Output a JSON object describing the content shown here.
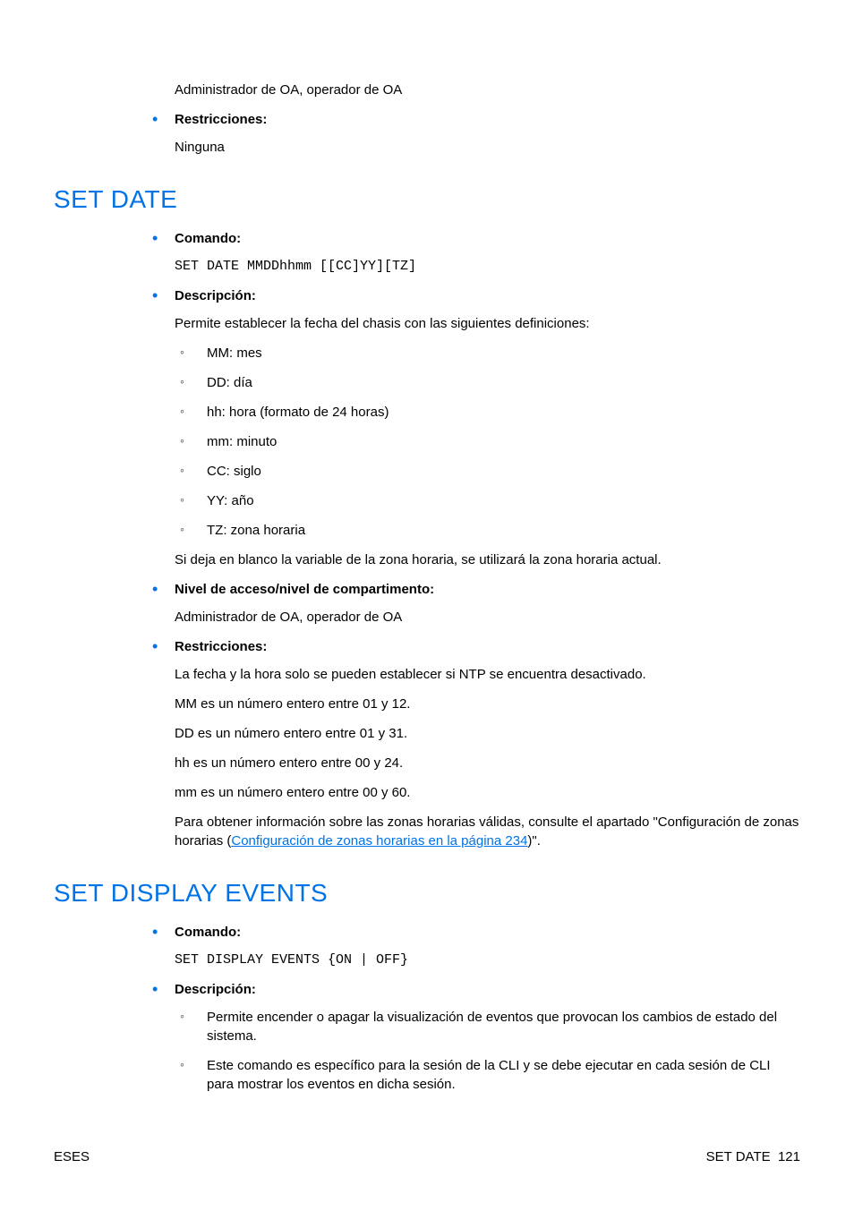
{
  "intro": {
    "access_body": "Administrador de OA, operador de OA",
    "restricciones_label": "Restricciones:",
    "restricciones_body": "Ninguna"
  },
  "set_date": {
    "heading": "SET DATE",
    "comando_label": "Comando:",
    "comando_code": "SET DATE MMDDhhmm [[CC]YY][TZ]",
    "descripcion_label": "Descripción:",
    "descripcion_intro": "Permite establecer la fecha del chasis con las siguientes definiciones:",
    "defs": [
      "MM: mes",
      "DD: día",
      "hh: hora (formato de 24 horas)",
      "mm: minuto",
      "CC: siglo",
      "YY: año",
      "TZ: zona horaria"
    ],
    "descripcion_note": "Si deja en blanco la variable de la zona horaria, se utilizará la zona horaria actual.",
    "nivel_label": "Nivel de acceso/nivel de compartimento:",
    "nivel_body": "Administrador de OA, operador de OA",
    "restricciones_label": "Restricciones:",
    "restricciones": [
      "La fecha y la hora solo se pueden establecer si NTP se encuentra desactivado.",
      "MM es un número entero entre 01 y 12.",
      "DD es un número entero entre 01 y 31.",
      "hh es un número entero entre 00 y 24.",
      "mm es un número entero entre 00 y 60."
    ],
    "restricciones_final_pre": "Para obtener información sobre las zonas horarias válidas, consulte el apartado \"Configuración de zonas horarias (",
    "restricciones_link": "Configuración de zonas horarias en la página 234",
    "restricciones_final_post": ")\"."
  },
  "set_display_events": {
    "heading": "SET DISPLAY EVENTS",
    "comando_label": "Comando:",
    "comando_code": "SET DISPLAY EVENTS {ON | OFF}",
    "descripcion_label": "Descripción:",
    "desc_items": [
      "Permite encender o apagar la visualización de eventos que provocan los cambios de estado del sistema.",
      "Este comando es específico para la sesión de la CLI y se debe ejecutar en cada sesión de CLI para mostrar los eventos en dicha sesión."
    ]
  },
  "footer": {
    "left": "ESES",
    "right_label": "SET DATE",
    "right_page": "121"
  }
}
